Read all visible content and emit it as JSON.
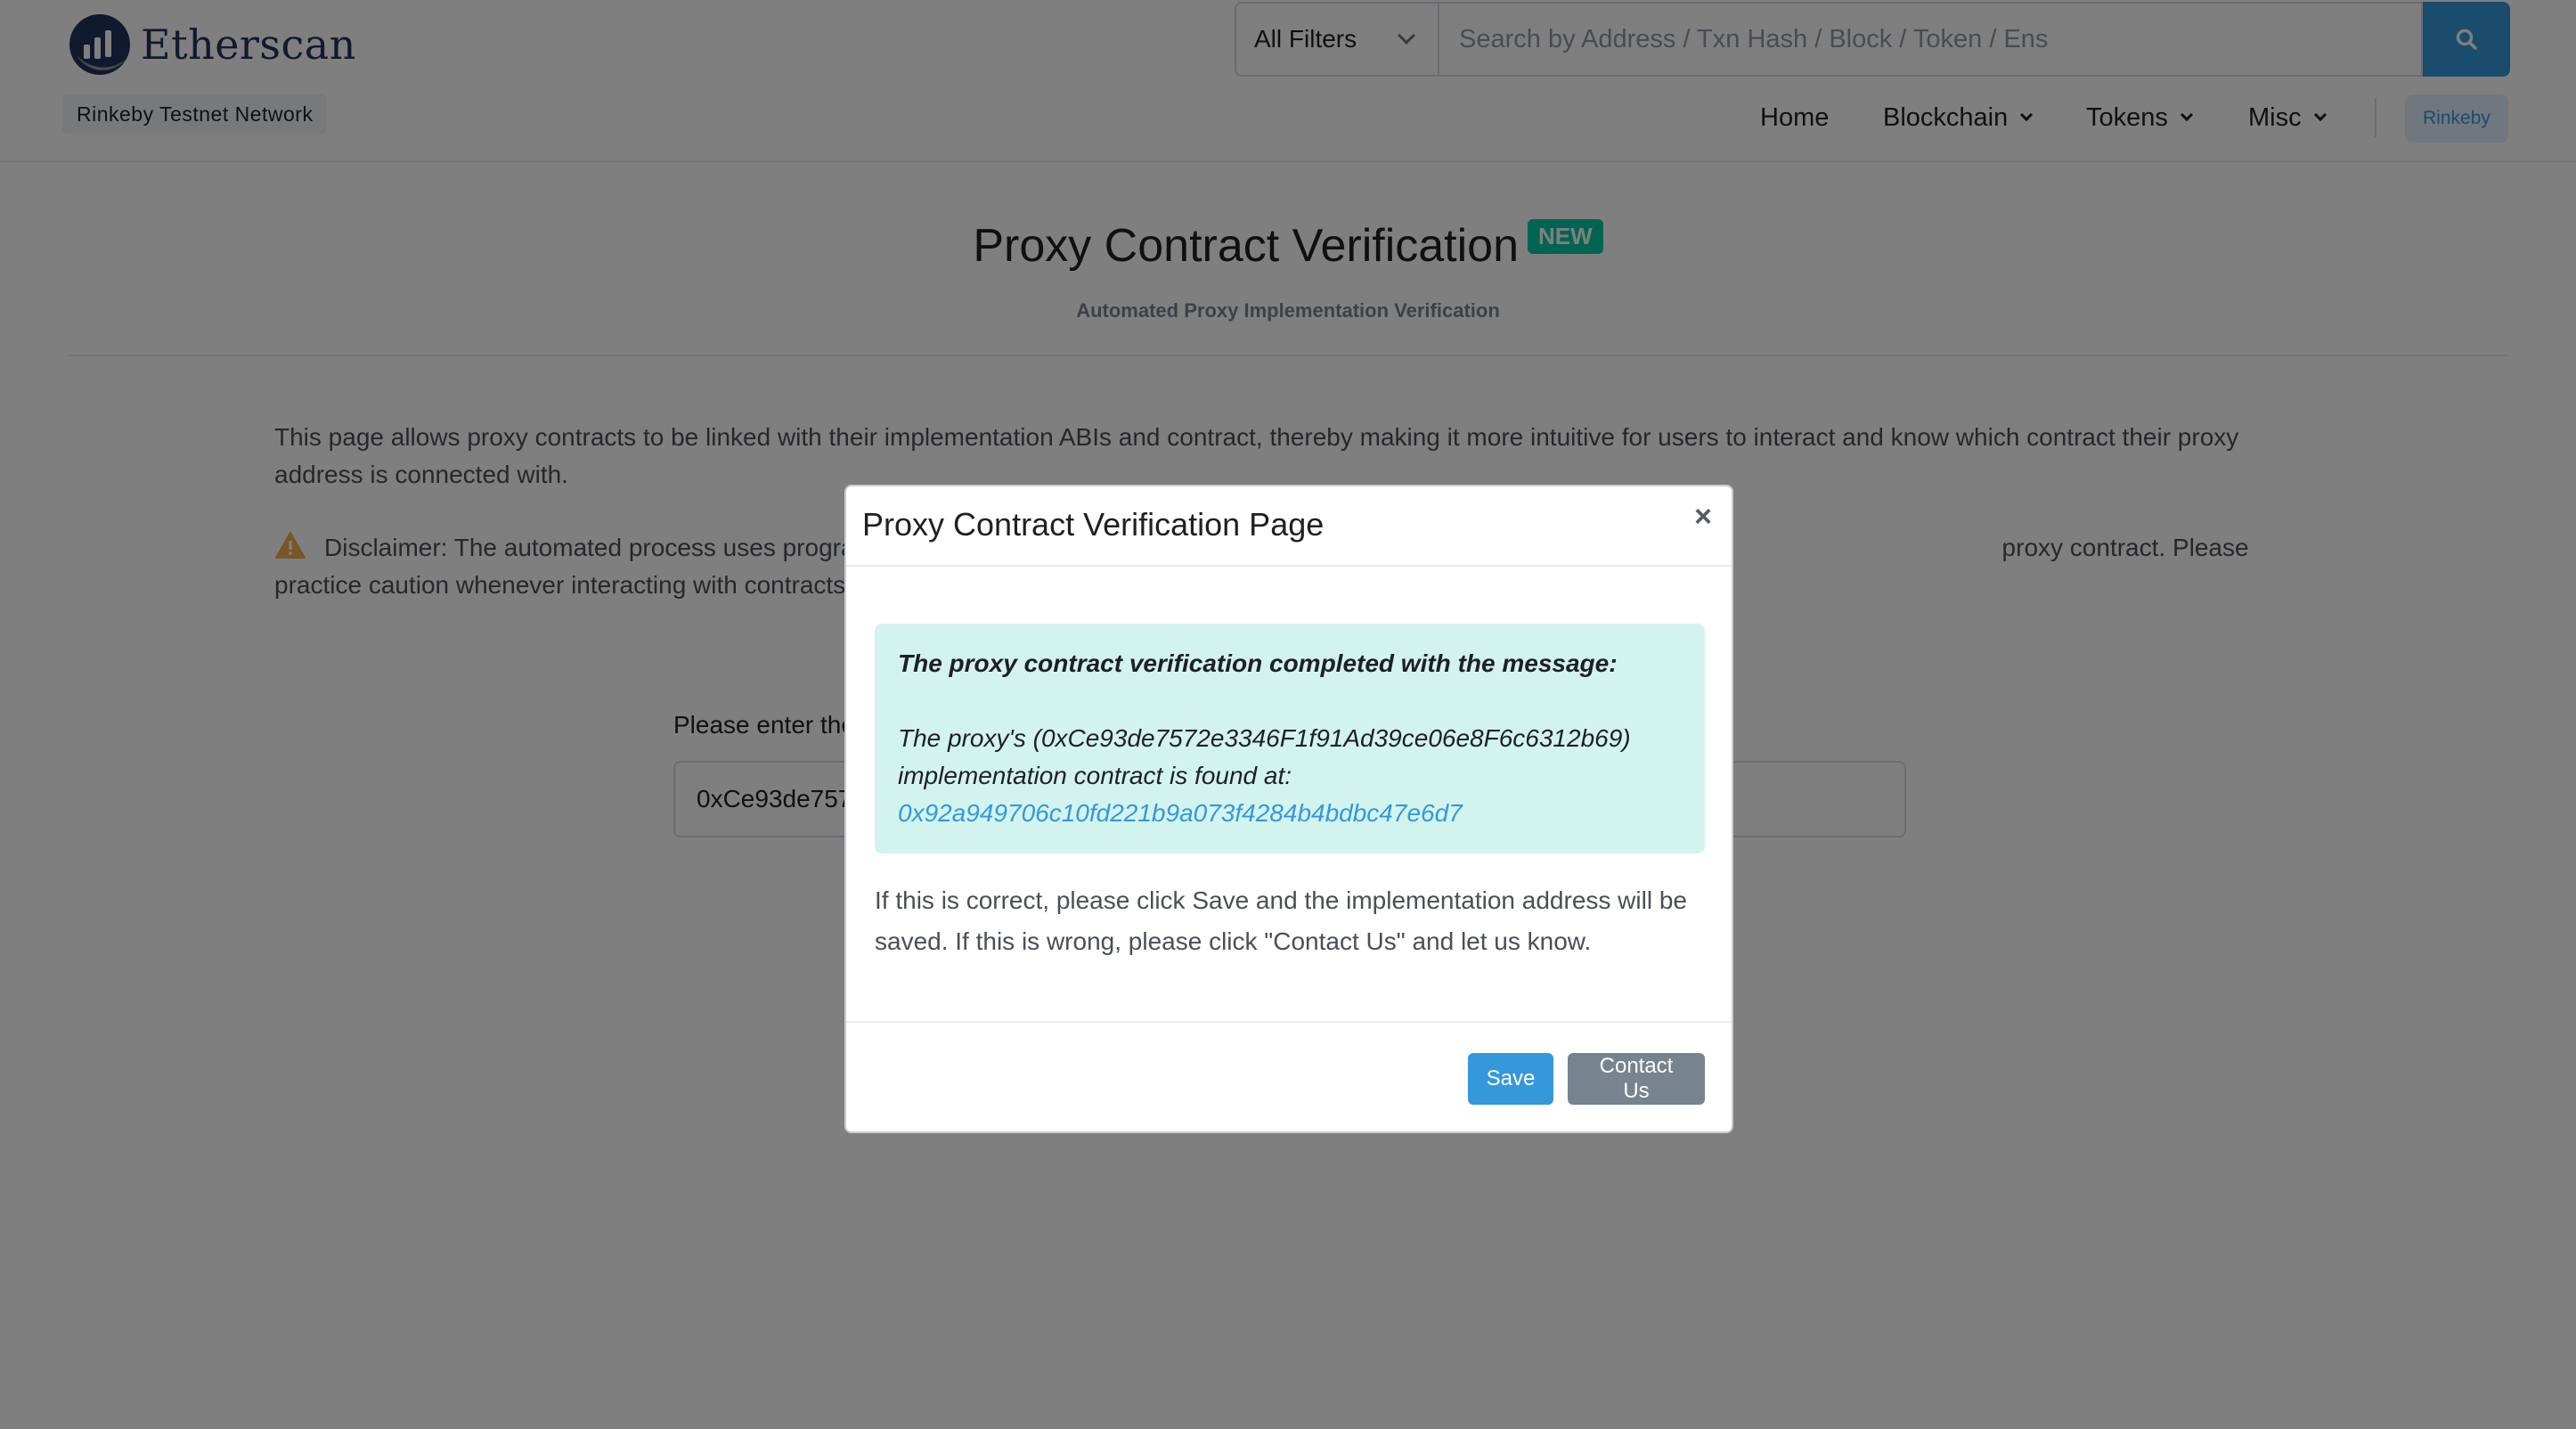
{
  "header": {
    "logo_text": "Etherscan",
    "network_badge": "Rinkeby Testnet Network",
    "filter_label": "All Filters",
    "search_placeholder": "Search by Address / Txn Hash / Block / Token / Ens",
    "nav": {
      "home": "Home",
      "blockchain": "Blockchain",
      "tokens": "Tokens",
      "misc": "Misc"
    },
    "network_button": "Rinkeby"
  },
  "page": {
    "title": "Proxy Contract Verification",
    "new_badge": "NEW",
    "subtitle": "Automated Proxy Implementation Verification",
    "intro": "This page allows proxy contracts to be linked with their implementation ABIs and contract, thereby making it more intuitive for users to interact and know which contract their proxy address is connected with.",
    "disclaimer": "Disclaimer: The automated process uses progra",
    "disclaimer_tail": "proxy contract. Please practice caution whenever interacting with contracts on Ethereum.",
    "address_label": "Please enter the",
    "address_value": "0xCe93de757"
  },
  "modal": {
    "title": "Proxy Contract Verification Page",
    "close": "×",
    "alert_heading": "The proxy contract verification completed with the message:",
    "alert_line": "The proxy's (0xCe93de7572e3346F1f91Ad39ce06e8F6c6312b69) implementation contract is found at:",
    "alert_link": "0x92a949706c10fd221b9a073f4284b4bdbc47e6d7",
    "body_text": "If this is correct, please click Save and the implementation address will be saved. If this is wrong, please click \"Contact Us\" and let us know.",
    "save_label": "Save",
    "contact_label": "Contact Us"
  },
  "colors": {
    "accent": "#3498db",
    "success_bg": "#d3f4ee",
    "badge": "#00c9a7",
    "warning": "#f0ad4e"
  }
}
